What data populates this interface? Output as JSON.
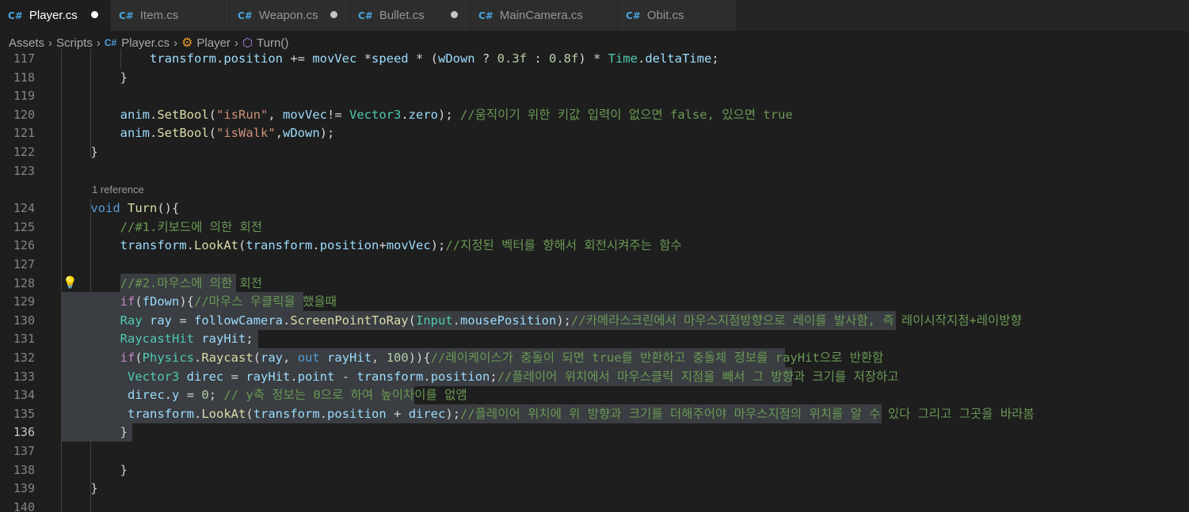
{
  "tabs": [
    {
      "label": "Player.cs",
      "active": true,
      "dirty": true,
      "icon": "csharp-file-icon"
    },
    {
      "label": "Item.cs",
      "active": false,
      "dirty": false,
      "icon": "csharp-file-icon"
    },
    {
      "label": "Weapon.cs",
      "active": false,
      "dirty": true,
      "icon": "csharp-file-icon"
    },
    {
      "label": "Bullet.cs",
      "active": false,
      "dirty": true,
      "icon": "csharp-file-icon"
    },
    {
      "label": "MainCamera.cs",
      "active": false,
      "dirty": false,
      "icon": "csharp-file-icon"
    },
    {
      "label": "Obit.cs",
      "active": false,
      "dirty": false,
      "icon": "csharp-file-icon"
    }
  ],
  "breadcrumb": {
    "assets": "Assets",
    "scripts": "Scripts",
    "file": "Player.cs",
    "class": "Player",
    "method": "Turn()"
  },
  "codelens": "1 reference",
  "current_line": "136",
  "colors": {
    "background": "#1e1e1e",
    "tab_bar": "#252526",
    "selection": "#3a3d41",
    "keyword": "#569cd6",
    "type": "#4ec9b0",
    "function": "#dcdcaa",
    "variable": "#9cdcfe",
    "string": "#ce9178",
    "number": "#b5cea8",
    "comment": "#6a9955",
    "control": "#c586c0"
  },
  "lines": [
    {
      "num": "117",
      "tokens": [
        [
          "p",
          "            "
        ],
        [
          "v",
          "transform"
        ],
        [
          "p",
          "."
        ],
        [
          "v",
          "position"
        ],
        [
          "p",
          " += "
        ],
        [
          "v",
          "movVec"
        ],
        [
          "p",
          " *"
        ],
        [
          "v",
          "speed"
        ],
        [
          "p",
          " * ("
        ],
        [
          "v",
          "wDown"
        ],
        [
          "p",
          " ? "
        ],
        [
          "n",
          "0.3f"
        ],
        [
          "p",
          " : "
        ],
        [
          "n",
          "0.8f"
        ],
        [
          "p",
          ") * "
        ],
        [
          "t",
          "Time"
        ],
        [
          "p",
          "."
        ],
        [
          "v",
          "deltaTime"
        ],
        [
          "p",
          ";"
        ]
      ]
    },
    {
      "num": "118",
      "tokens": [
        [
          "p",
          "        }"
        ]
      ]
    },
    {
      "num": "119",
      "tokens": []
    },
    {
      "num": "120",
      "tokens": [
        [
          "p",
          "        "
        ],
        [
          "v",
          "anim"
        ],
        [
          "p",
          "."
        ],
        [
          "f",
          "SetBool"
        ],
        [
          "p",
          "("
        ],
        [
          "s",
          "\"isRun\""
        ],
        [
          "p",
          ", "
        ],
        [
          "v",
          "movVec"
        ],
        [
          "p",
          "!= "
        ],
        [
          "t",
          "Vector3"
        ],
        [
          "p",
          "."
        ],
        [
          "v",
          "zero"
        ],
        [
          "p",
          "); "
        ],
        [
          "c",
          "//움직이기 위한 키값 입력이 없으면 false, 있으면 true"
        ]
      ]
    },
    {
      "num": "121",
      "tokens": [
        [
          "p",
          "        "
        ],
        [
          "v",
          "anim"
        ],
        [
          "p",
          "."
        ],
        [
          "f",
          "SetBool"
        ],
        [
          "p",
          "("
        ],
        [
          "s",
          "\"isWalk\""
        ],
        [
          "p",
          ","
        ],
        [
          "v",
          "wDown"
        ],
        [
          "p",
          ");"
        ]
      ]
    },
    {
      "num": "122",
      "tokens": [
        [
          "p",
          "    }"
        ]
      ]
    },
    {
      "num": "123",
      "tokens": []
    },
    {
      "num": "124",
      "tokens": [
        [
          "p",
          "    "
        ],
        [
          "k",
          "void"
        ],
        [
          "p",
          " "
        ],
        [
          "f",
          "Turn"
        ],
        [
          "p",
          "(){"
        ]
      ]
    },
    {
      "num": "125",
      "tokens": [
        [
          "p",
          "        "
        ],
        [
          "c",
          "//#1.키보드에 의한 회전"
        ]
      ]
    },
    {
      "num": "126",
      "tokens": [
        [
          "p",
          "        "
        ],
        [
          "v",
          "transform"
        ],
        [
          "p",
          "."
        ],
        [
          "f",
          "LookAt"
        ],
        [
          "p",
          "("
        ],
        [
          "v",
          "transform"
        ],
        [
          "p",
          "."
        ],
        [
          "v",
          "position"
        ],
        [
          "p",
          "+"
        ],
        [
          "v",
          "movVec"
        ],
        [
          "p",
          ");"
        ],
        [
          "c",
          "//지정된 벡터를 향해서 회전시켜주는 함수"
        ]
      ]
    },
    {
      "num": "127",
      "tokens": []
    },
    {
      "num": "128",
      "tokens": [
        [
          "p",
          "        "
        ],
        [
          "c",
          "//#2.마우스에 의한 회전"
        ]
      ]
    },
    {
      "num": "129",
      "tokens": [
        [
          "p",
          "        "
        ],
        [
          "kc",
          "if"
        ],
        [
          "p",
          "("
        ],
        [
          "v",
          "fDown"
        ],
        [
          "p",
          "){"
        ],
        [
          "c",
          "//마우스 우클릭을 했을때"
        ]
      ]
    },
    {
      "num": "130",
      "tokens": [
        [
          "p",
          "        "
        ],
        [
          "t",
          "Ray"
        ],
        [
          "p",
          " "
        ],
        [
          "v",
          "ray"
        ],
        [
          "p",
          " = "
        ],
        [
          "v",
          "followCamera"
        ],
        [
          "p",
          "."
        ],
        [
          "f",
          "ScreenPointToRay"
        ],
        [
          "p",
          "("
        ],
        [
          "t",
          "Input"
        ],
        [
          "p",
          "."
        ],
        [
          "v",
          "mousePosition"
        ],
        [
          "p",
          ");"
        ],
        [
          "c",
          "//카메라스크린에서 마우스지점방향으로 레이를 발사함, 즉 레이시작지점+레이방향"
        ]
      ]
    },
    {
      "num": "131",
      "tokens": [
        [
          "p",
          "        "
        ],
        [
          "t",
          "RaycastHit"
        ],
        [
          "p",
          " "
        ],
        [
          "v",
          "rayHit"
        ],
        [
          "p",
          ";"
        ]
      ]
    },
    {
      "num": "132",
      "tokens": [
        [
          "p",
          "        "
        ],
        [
          "kc",
          "if"
        ],
        [
          "p",
          "("
        ],
        [
          "t",
          "Physics"
        ],
        [
          "p",
          "."
        ],
        [
          "f",
          "Raycast"
        ],
        [
          "p",
          "("
        ],
        [
          "v",
          "ray"
        ],
        [
          "p",
          ", "
        ],
        [
          "k",
          "out"
        ],
        [
          "p",
          " "
        ],
        [
          "v",
          "rayHit"
        ],
        [
          "p",
          ", "
        ],
        [
          "n",
          "100"
        ],
        [
          "p",
          "))"
        ],
        [
          "p",
          "{"
        ],
        [
          "c",
          "//레이케이스가 충돌이 되면 true를 반환하고 충돌체 정보를 rayHit으로 반환함"
        ]
      ]
    },
    {
      "num": "133",
      "tokens": [
        [
          "p",
          "         "
        ],
        [
          "t",
          "Vector3"
        ],
        [
          "p",
          " "
        ],
        [
          "v",
          "direc"
        ],
        [
          "p",
          " = "
        ],
        [
          "v",
          "rayHit"
        ],
        [
          "p",
          "."
        ],
        [
          "v",
          "point"
        ],
        [
          "p",
          " - "
        ],
        [
          "v",
          "transform"
        ],
        [
          "p",
          "."
        ],
        [
          "v",
          "position"
        ],
        [
          "p",
          ";"
        ],
        [
          "c",
          "//플레이어 위치에서 마우스클릭 지점을 빼서 그 방향과 크기를 저장하고"
        ]
      ]
    },
    {
      "num": "134",
      "tokens": [
        [
          "p",
          "         "
        ],
        [
          "v",
          "direc"
        ],
        [
          "p",
          "."
        ],
        [
          "v",
          "y"
        ],
        [
          "p",
          " = "
        ],
        [
          "n",
          "0"
        ],
        [
          "p",
          "; "
        ],
        [
          "c",
          "// y축 정보는 0으로 하여 높이차이를 없앰"
        ]
      ]
    },
    {
      "num": "135",
      "tokens": [
        [
          "p",
          "         "
        ],
        [
          "v",
          "transform"
        ],
        [
          "p",
          "."
        ],
        [
          "f",
          "LookAt"
        ],
        [
          "p",
          "("
        ],
        [
          "v",
          "transform"
        ],
        [
          "p",
          "."
        ],
        [
          "v",
          "position"
        ],
        [
          "p",
          " + "
        ],
        [
          "v",
          "direc"
        ],
        [
          "p",
          ");"
        ],
        [
          "c",
          "//플레이어 위치에 위 방향과 크기를 더해주어야 마우스지점의 위치를 알 수 있다 그리고 그곳을 바라봄"
        ]
      ]
    },
    {
      "num": "136",
      "tokens": [
        [
          "p",
          "        }"
        ]
      ]
    },
    {
      "num": "137",
      "tokens": []
    },
    {
      "num": "138",
      "tokens": [
        [
          "p",
          "        }"
        ]
      ]
    },
    {
      "num": "139",
      "tokens": [
        [
          "p",
          "    }"
        ]
      ]
    },
    {
      "num": "140",
      "tokens": []
    }
  ]
}
